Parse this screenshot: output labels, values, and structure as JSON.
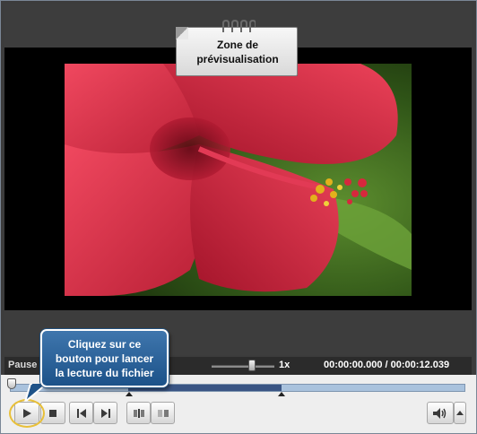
{
  "callouts": {
    "preview_zone": {
      "line1": "Zone de",
      "line2": "prévisualisation"
    },
    "play_hint": {
      "line1": "Cliquez sur ce",
      "line2": "bouton pour lancer",
      "line3": "la lecture du fichier"
    }
  },
  "status": {
    "state": "Pause",
    "speed": "1x",
    "current_time": "00:00:00.000",
    "separator": "/",
    "total_time": "00:00:12.039"
  },
  "timeline": {
    "selection_start_fraction": 0.26,
    "selection_end_fraction": 0.6
  },
  "controls": {
    "buttons": [
      "play-icon",
      "stop-icon",
      "previous-frame-icon",
      "next-frame-icon",
      "split-view-icon",
      "side-by-side-icon",
      "volume-icon",
      "volume-dropdown-icon"
    ]
  },
  "colors": {
    "tooltip_blue": "#2a5f95",
    "highlight_ring": "#e8c03a",
    "timeline_selection": "#3a5584"
  },
  "preview_image": {
    "subject": "red hibiscus flower"
  }
}
